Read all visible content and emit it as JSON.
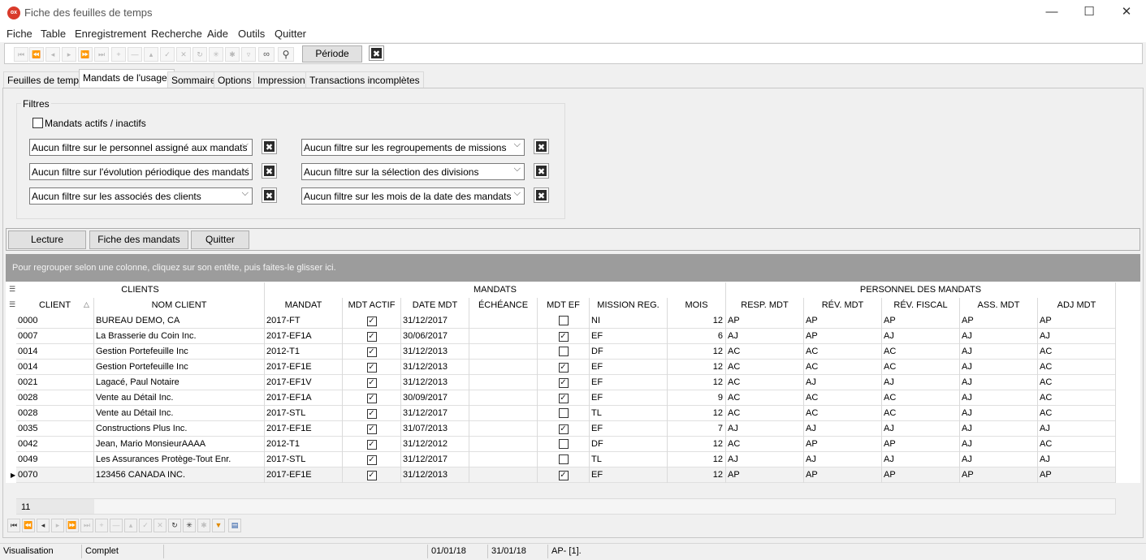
{
  "window": {
    "title": "Fiche des feuilles de temps",
    "app_icon": "ox",
    "minimize": "—",
    "maximize": "☐",
    "close": "✕"
  },
  "menu": [
    "Fiche",
    "Table",
    "Enregistrement",
    "Recherche",
    "Aide",
    "Outils",
    "Quitter"
  ],
  "toolbar": {
    "icons": [
      "first-icon",
      "prev-page-icon",
      "prev-icon",
      "next-icon",
      "next-page-icon",
      "last-icon",
      "insert-icon",
      "delete-icon",
      "edit-icon",
      "post-icon",
      "cancel-icon",
      "refresh-icon",
      "asterisk-icon",
      "asterisk2-icon",
      "filter-icon",
      "binoculars-icon",
      "search-icon"
    ],
    "periode_label": "Période",
    "clear_icon": "✖"
  },
  "tabs": [
    "Feuilles de temps",
    "Mandats de l'usager",
    "Sommaire",
    "Options",
    "Impression",
    "Transactions incomplètes"
  ],
  "active_tab": "Mandats de l'usager",
  "filters": {
    "title": "Filtres",
    "checkbox_label": "Mandats actifs / inactifs",
    "checkbox_checked": false,
    "left": [
      "Aucun filtre sur le personnel assigné aux mandats",
      "Aucun filtre sur l'évolution périodique des mandats",
      "Aucun filtre sur les associés des clients"
    ],
    "right": [
      "Aucun filtre sur les regroupements de missions",
      "Aucun filtre sur la sélection des divisions",
      "Aucun filtre sur les mois de la date des mandats"
    ],
    "clear_icon": "✖"
  },
  "actions": [
    "Lecture",
    "Fiche des mandats",
    "Quitter"
  ],
  "grid": {
    "group_hint": "Pour regrouper selon une colonne, cliquez sur son entête, puis faites-le glisser ici.",
    "bands": [
      "CLIENTS",
      "MANDATS",
      "PERSONNEL DES MANDATS"
    ],
    "columns": [
      "CLIENT",
      "NOM CLIENT",
      "MANDAT",
      "MDT ACTIF",
      "DATE MDT",
      "ÉCHÉANCE",
      "MDT EF",
      "MISSION REG.",
      "MOIS",
      "RESP. MDT",
      "RÉV. MDT",
      "RÉV. FISCAL",
      "ASS. MDT",
      "ADJ MDT"
    ],
    "sort_icon": "△",
    "rows": [
      [
        "0000",
        "BUREAU DEMO, CA",
        "2017-FT",
        true,
        "31/12/2017",
        "",
        false,
        "NI",
        "12",
        "AP",
        "AP",
        "AP",
        "AP",
        "AP"
      ],
      [
        "0007",
        "La Brasserie du Coin Inc.",
        "2017-EF1A",
        true,
        "30/06/2017",
        "",
        true,
        "EF",
        "6",
        "AJ",
        "AP",
        "AJ",
        "AJ",
        "AJ"
      ],
      [
        "0014",
        "Gestion Portefeuille Inc",
        "2012-T1",
        true,
        "31/12/2013",
        "",
        false,
        "DF",
        "12",
        "AC",
        "AC",
        "AC",
        "AJ",
        "AC"
      ],
      [
        "0014",
        "Gestion Portefeuille Inc",
        "2017-EF1E",
        true,
        "31/12/2013",
        "",
        true,
        "EF",
        "12",
        "AC",
        "AC",
        "AC",
        "AJ",
        "AC"
      ],
      [
        "0021",
        "Lagacé, Paul Notaire",
        "2017-EF1V",
        true,
        "31/12/2013",
        "",
        true,
        "EF",
        "12",
        "AC",
        "AJ",
        "AJ",
        "AJ",
        "AC"
      ],
      [
        "0028",
        "Vente au Détail Inc.",
        "2017-EF1A",
        true,
        "30/09/2017",
        "",
        true,
        "EF",
        "9",
        "AC",
        "AC",
        "AC",
        "AJ",
        "AC"
      ],
      [
        "0028",
        "Vente au Détail Inc.",
        "2017-STL",
        true,
        "31/12/2017",
        "",
        false,
        "TL",
        "12",
        "AC",
        "AC",
        "AC",
        "AJ",
        "AC"
      ],
      [
        "0035",
        "Constructions Plus  Inc.",
        "2017-EF1E",
        true,
        "31/07/2013",
        "",
        true,
        "EF",
        "7",
        "AJ",
        "AJ",
        "AJ",
        "AJ",
        "AJ"
      ],
      [
        "0042",
        "Jean, Mario MonsieurAAAA",
        "2012-T1",
        true,
        "31/12/2012",
        "",
        false,
        "DF",
        "12",
        "AC",
        "AP",
        "AP",
        "AJ",
        "AC"
      ],
      [
        "0049",
        "Les Assurances Protège-Tout Enr.",
        "2017-STL",
        true,
        "31/12/2017",
        "",
        false,
        "TL",
        "12",
        "AJ",
        "AJ",
        "AJ",
        "AJ",
        "AJ"
      ],
      [
        "0070",
        "123456 CANADA INC.",
        "2017-EF1E",
        true,
        "31/12/2013",
        "",
        true,
        "EF",
        "12",
        "AP",
        "AP",
        "AP",
        "AP",
        "AP"
      ]
    ],
    "selected_row": 10,
    "footer_count": "11",
    "row_marker": "▶"
  },
  "navigator": {
    "icons": [
      "first-icon",
      "prev-page-icon",
      "prev-icon",
      "next-icon",
      "next-page-icon",
      "last-icon",
      "insert-icon",
      "delete-icon",
      "edit-icon",
      "post-icon",
      "cancel-icon",
      "refresh-icon",
      "asterisk-icon",
      "asterisk2-icon",
      "filter-icon",
      "save-icon"
    ]
  },
  "statusbar": [
    "Visualisation",
    "Complet",
    "",
    "01/01/18",
    "31/01/18",
    "AP- [1]."
  ]
}
